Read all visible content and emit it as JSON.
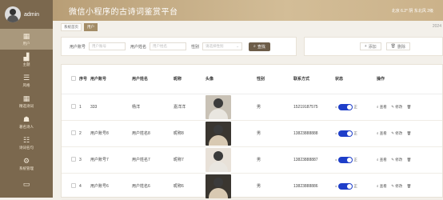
{
  "sidebar": {
    "username": "admin",
    "items": [
      {
        "label": "用户",
        "icon": "grid-icon",
        "active": true
      },
      {
        "label": "主题"
      },
      {
        "label": "风格"
      },
      {
        "label": "精选诗词"
      },
      {
        "label": "著名诗人"
      },
      {
        "label": "诗词名句"
      },
      {
        "label": "系统管理"
      },
      {
        "label": ""
      }
    ]
  },
  "header": {
    "title": "微信小程序的古诗词鉴赏平台",
    "right": "北京 6.2° 阴 东北风 2级"
  },
  "breadcrumb": {
    "home": "系统首页",
    "current": "用户",
    "year": "2024"
  },
  "search": {
    "account_label": "用户账号",
    "account_placeholder": "用户账号",
    "name_label": "用户姓名",
    "name_placeholder": "用户姓名",
    "gender_label": "性别",
    "gender_placeholder": "请选择性别",
    "search_button": "查找"
  },
  "actions": {
    "add": "添加",
    "delete": "删除"
  },
  "table": {
    "headers": {
      "index": "序号",
      "account": "用户账号",
      "name": "用户姓名",
      "nickname": "昵称",
      "avatar": "头像",
      "gender": "性别",
      "phone": "联系方式",
      "status": "状态",
      "ops": "操作"
    },
    "rows": [
      {
        "index": "1",
        "account": "333",
        "name": "杨洋",
        "nickname": "嘉洋洋",
        "gender": "男",
        "phone": "15219187575",
        "photo": "man"
      },
      {
        "index": "2",
        "account": "用户账号8",
        "name": "用户姓名8",
        "nickname": "昵称8",
        "gender": "男",
        "phone": "13823888888",
        "photo": "dark"
      },
      {
        "index": "3",
        "account": "用户账号7",
        "name": "用户姓名7",
        "nickname": "昵称7",
        "gender": "男",
        "phone": "13823888887",
        "photo": "girl"
      },
      {
        "index": "4",
        "account": "用户账号6",
        "name": "用户姓名6",
        "nickname": "昵称6",
        "gender": "男",
        "phone": "13823888886",
        "photo": "dark"
      }
    ],
    "status_caption_left": "<",
    "status_caption_right": "正",
    "op_view": "查看",
    "op_edit": "修改",
    "op_delete": "删除"
  }
}
